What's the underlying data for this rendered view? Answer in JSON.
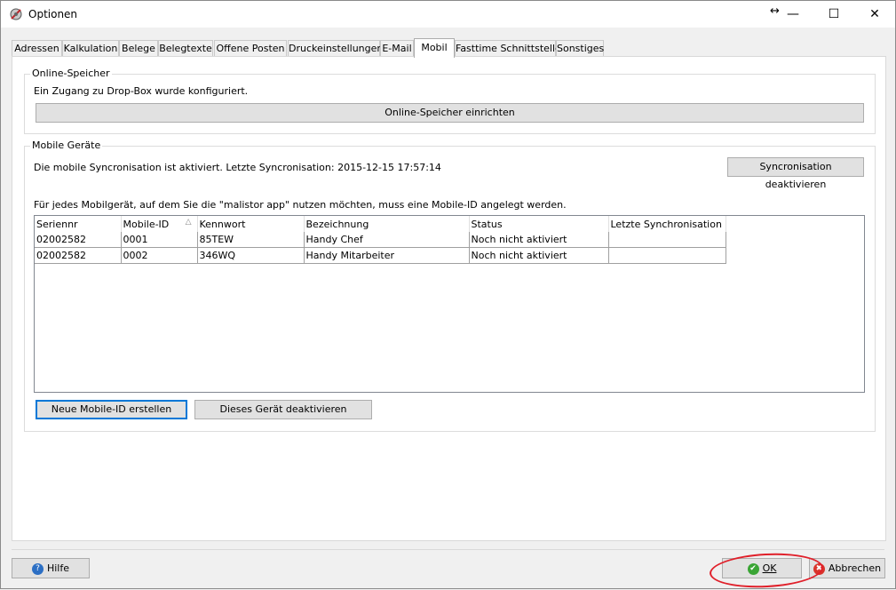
{
  "window": {
    "title": "Optionen",
    "minimize_glyph": "—",
    "maximize_glyph": "☐",
    "close_glyph": "✕",
    "resize_glyph": "↔"
  },
  "tabs": [
    {
      "label": "Adressen"
    },
    {
      "label": "Kalkulation"
    },
    {
      "label": "Belege"
    },
    {
      "label": "Belegtexte"
    },
    {
      "label": "Offene Posten"
    },
    {
      "label": "Druckeinstellungen"
    },
    {
      "label": "E-Mail"
    },
    {
      "label": "Mobil",
      "active": true
    },
    {
      "label": "Fasttime Schnittstelle"
    },
    {
      "label": "Sonstiges"
    }
  ],
  "online_storage": {
    "title": "Online-Speicher",
    "status_text": "Ein Zugang zu Drop-Box wurde konfiguriert.",
    "setup_button": "Online-Speicher einrichten"
  },
  "mobile_devices": {
    "title": "Mobile Geräte",
    "sync_status": "Die mobile Syncronisation ist aktiviert. Letzte Syncronisation: 2015-12-15 17:57:14",
    "deactivate_sync_button": "Syncronisation deaktivieren",
    "info_text": "Für jedes Mobilgerät, auf dem Sie die \"malistor app\" nutzen möchten, muss eine Mobile-ID angelegt werden.",
    "columns": [
      "Seriennr",
      "Mobile-ID",
      "Kennwort",
      "Bezeichnung",
      "Status",
      "Letzte Synchronisation"
    ],
    "sort_glyph": "△",
    "rows": [
      [
        "02002582",
        "0001",
        "85TEW",
        "Handy Chef",
        "Noch nicht aktiviert",
        ""
      ],
      [
        "02002582",
        "0002",
        "346WQ",
        "Handy Mitarbeiter",
        "Noch nicht aktiviert",
        ""
      ]
    ],
    "new_id_button": "Neue Mobile-ID erstellen",
    "deactivate_device_button": "Dieses Gerät deaktivieren"
  },
  "footer": {
    "help_button": "Hilfe",
    "ok_button": "OK",
    "cancel_button": "Abbrechen",
    "help_icon_glyph": "?",
    "ok_icon_glyph": "✔",
    "cancel_icon_glyph": "✖"
  },
  "colors": {
    "accent": "#0078d7",
    "highlight_circle": "#e0202a",
    "ok_icon": "#3aa535",
    "cancel_icon": "#d9342b",
    "help_icon": "#2c6fc4"
  }
}
